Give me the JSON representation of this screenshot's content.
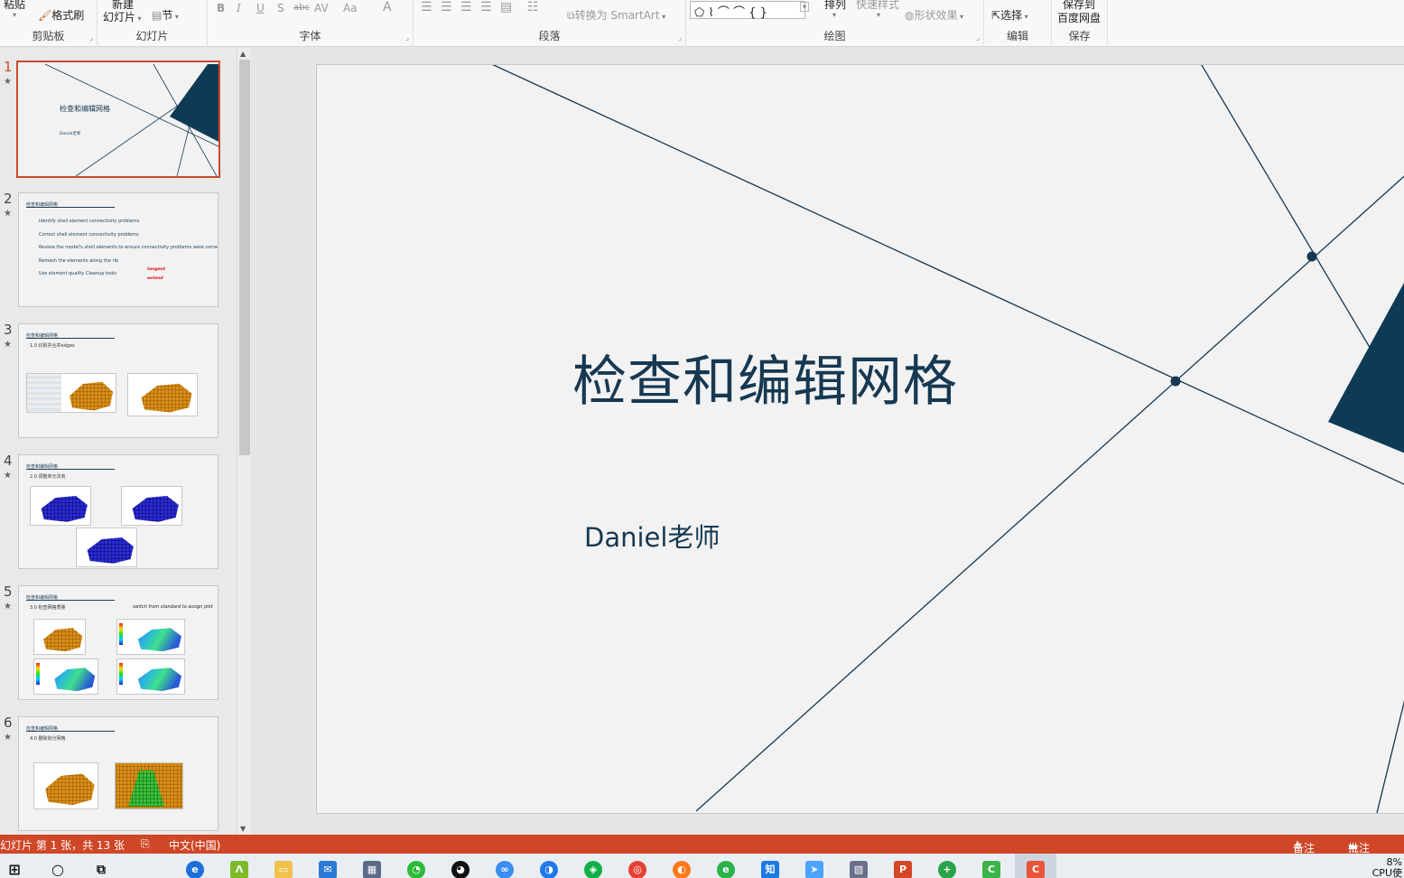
{
  "ribbon": {
    "clipboard": {
      "paste": "粘贴",
      "format_painter": "格式刷",
      "label": "剪贴板"
    },
    "slides": {
      "new_slide_l1": "新建",
      "new_slide_l2": "幻灯片",
      "section": "节",
      "label": "幻灯片"
    },
    "font": {
      "bold": "B",
      "italic": "I",
      "underline": "U",
      "shadow": "S",
      "strike": "abc",
      "spacing": "AV",
      "case": "Aa",
      "color": "A",
      "label": "字体"
    },
    "paragraph": {
      "smartart": "转换为 SmartArt",
      "label": "段落"
    },
    "drawing": {
      "shapes": "⬠ ⌇ ⌒ ⌒ { }",
      "arrange": "排列",
      "quick_styles": "快速样式",
      "shape_effects": "形状效果",
      "label": "绘图"
    },
    "editing": {
      "select": "选择",
      "label": "编辑"
    },
    "save": {
      "save_to_l1": "保存到",
      "save_to_l2": "百度网盘",
      "label": "保存"
    }
  },
  "thumbnails": [
    {
      "number": "1",
      "title": "检查和编辑网格",
      "subtitle": "Daniel老师"
    },
    {
      "number": "2",
      "header": "检查和编辑网格",
      "bullets": [
        "Identify shell element connectivity problems",
        "Correct shell element connectivity problems",
        "Review the model's shell elements to ensure connectivity problems were corrected",
        "Remesh the elements along the rib",
        "Use element quality Cleanup tools"
      ],
      "notes": [
        "tangent",
        "extend"
      ]
    },
    {
      "number": "3",
      "header": "检查和编辑网格",
      "sub": "1.0 识别并合并edges"
    },
    {
      "number": "4",
      "header": "检查和编辑网格",
      "sub": "2.0 调整单元法向"
    },
    {
      "number": "5",
      "header": "检查和编辑网格",
      "sub": "3.0 检查网格质量",
      "note": "switch from standard to assign plot"
    },
    {
      "number": "6",
      "header": "检查和编辑网格",
      "sub": "4.0 删除划分网格"
    }
  ],
  "slide": {
    "title": "检查和编辑网格",
    "subtitle": "Daniel老师"
  },
  "status": {
    "slide_info": "幻灯片 第 1 张，共 13 张",
    "language": "中文(中国)",
    "notes": "备注",
    "comments": "批注"
  },
  "taskbar": {
    "clock_l1": "8%",
    "clock_l2": "CPU使"
  },
  "colors": {
    "accent": "#cf4727",
    "slide_navy": "#163852",
    "slide_bg": "#f2f2f2"
  }
}
